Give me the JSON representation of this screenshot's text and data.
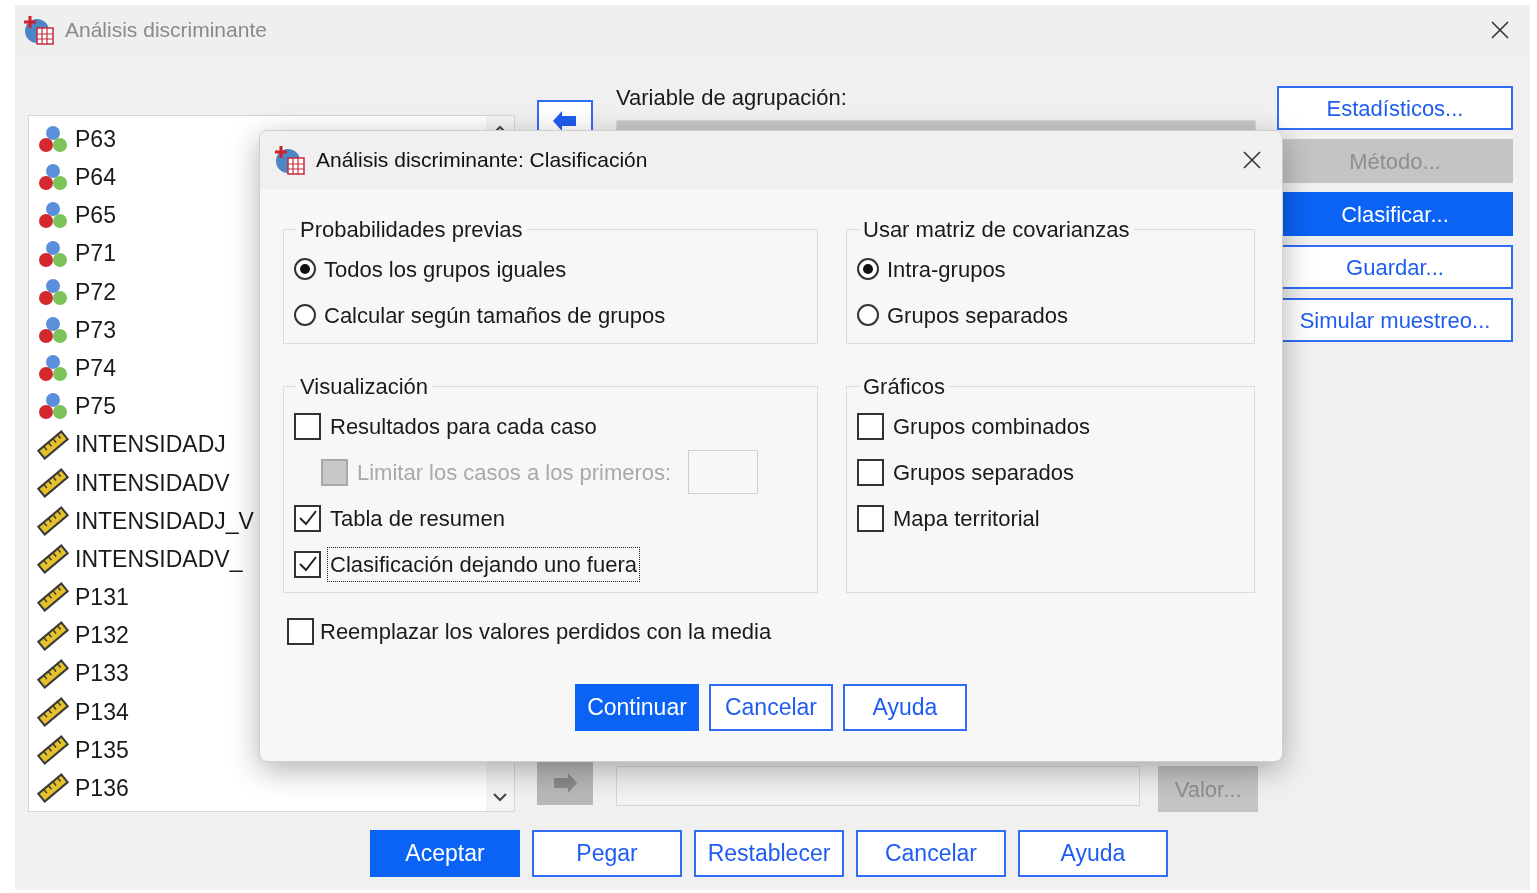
{
  "window": {
    "title": "Análisis discriminante"
  },
  "variables": [
    {
      "name": "P63",
      "kind": "nominal"
    },
    {
      "name": "P64",
      "kind": "nominal"
    },
    {
      "name": "P65",
      "kind": "nominal"
    },
    {
      "name": "P71",
      "kind": "nominal"
    },
    {
      "name": "P72",
      "kind": "nominal"
    },
    {
      "name": "P73",
      "kind": "nominal"
    },
    {
      "name": "P74",
      "kind": "nominal"
    },
    {
      "name": "P75",
      "kind": "nominal"
    },
    {
      "name": "INTENSIDADJ",
      "kind": "scale"
    },
    {
      "name": "INTENSIDADV",
      "kind": "scale"
    },
    {
      "name": "INTENSIDADJ_V",
      "kind": "scale"
    },
    {
      "name": "INTENSIDADV_",
      "kind": "scale"
    },
    {
      "name": "P131",
      "kind": "scale"
    },
    {
      "name": "P132",
      "kind": "scale"
    },
    {
      "name": "P133",
      "kind": "scale"
    },
    {
      "name": "P134",
      "kind": "scale"
    },
    {
      "name": "P135",
      "kind": "scale"
    },
    {
      "name": "P136",
      "kind": "scale"
    }
  ],
  "move_buttons": [
    {
      "disabled": false
    },
    {
      "disabled": true
    }
  ],
  "grouping": {
    "label": "Variable de agrupación:"
  },
  "range_button": {
    "label": "Valor...",
    "kind": "disabled"
  },
  "side_buttons": [
    {
      "label": "Estadísticos...",
      "kind": "normal"
    },
    {
      "label": "Método...",
      "kind": "disabled"
    },
    {
      "label": "Clasificar...",
      "kind": "primary"
    },
    {
      "label": "Guardar...",
      "kind": "normal"
    },
    {
      "label": "Simular muestreo...",
      "kind": "normal"
    }
  ],
  "footer_buttons": [
    {
      "label": "Aceptar",
      "kind": "primary"
    },
    {
      "label": "Pegar",
      "kind": "normal"
    },
    {
      "label": "Restablecer",
      "kind": "normal"
    },
    {
      "label": "Cancelar",
      "kind": "normal"
    },
    {
      "label": "Ayuda",
      "kind": "normal"
    }
  ],
  "dialog": {
    "title": "Análisis discriminante: Clasificación",
    "prior": {
      "legend": "Probabilidades previas",
      "options": [
        {
          "label": "Todos los grupos iguales",
          "selected": true
        },
        {
          "label": "Calcular según tamaños de grupos",
          "selected": false
        }
      ]
    },
    "covariance": {
      "legend": "Usar matriz de covarianzas",
      "options": [
        {
          "label": "Intra-grupos",
          "selected": true
        },
        {
          "label": "Grupos separados",
          "selected": false
        }
      ]
    },
    "display": {
      "legend": "Visualización",
      "items": [
        {
          "kind": "checkbox",
          "label": "Resultados para cada caso",
          "checked": false,
          "disabled": false,
          "focused": false
        },
        {
          "kind": "limit",
          "label": "Limitar los casos a los primeros:",
          "checked": false,
          "disabled": true,
          "focused": false
        },
        {
          "kind": "checkbox",
          "label": "Tabla de resumen",
          "checked": true,
          "disabled": false,
          "focused": false
        },
        {
          "kind": "checkbox",
          "label": "Clasificación dejando uno fuera",
          "checked": true,
          "disabled": false,
          "focused": true
        }
      ]
    },
    "plots": {
      "legend": "Gráficos",
      "items": [
        {
          "kind": "checkbox",
          "label": "Grupos combinados",
          "checked": false,
          "disabled": false,
          "focused": false
        },
        {
          "kind": "checkbox",
          "label": "Grupos separados",
          "checked": false,
          "disabled": false,
          "focused": false
        },
        {
          "kind": "checkbox",
          "label": "Mapa territorial",
          "checked": false,
          "disabled": false,
          "focused": false
        }
      ]
    },
    "replace_missing": {
      "label": "Reemplazar los valores perdidos con la media",
      "checked": false
    },
    "buttons": [
      {
        "label": "Continuar",
        "kind": "primary"
      },
      {
        "label": "Cancelar",
        "kind": "normal"
      },
      {
        "label": "Ayuda",
        "kind": "normal"
      }
    ]
  }
}
